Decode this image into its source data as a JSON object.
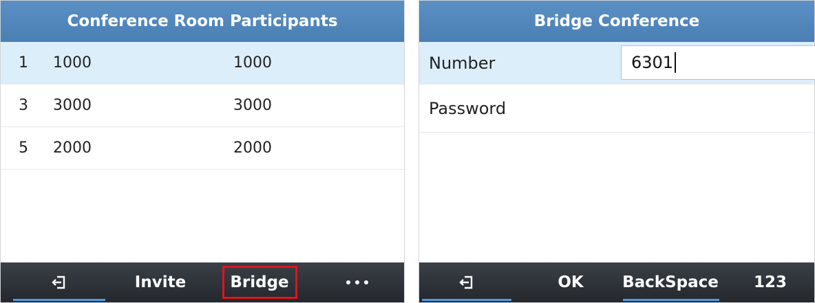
{
  "left": {
    "title": "Conference Room Participants",
    "participants": [
      {
        "index": "1",
        "number": "1000",
        "name": "1000",
        "selected": true
      },
      {
        "index": "3",
        "number": "3000",
        "name": "3000",
        "selected": false
      },
      {
        "index": "5",
        "number": "2000",
        "name": "2000",
        "selected": false
      }
    ],
    "softkeys": {
      "exit_icon": "exit-icon",
      "invite": "Invite",
      "bridge": "Bridge",
      "more_icon": "more-dots-icon"
    },
    "highlighted_softkey": "Bridge"
  },
  "right": {
    "title": "Bridge Conference",
    "number_label": "Number",
    "number_value": "6301",
    "password_label": "Password",
    "softkeys": {
      "exit_icon": "exit-icon",
      "ok": "OK",
      "backspace": "BackSpace",
      "input_mode": "123"
    }
  },
  "colors": {
    "title_bar": "#5a90c4",
    "selected_row": "#dceefa",
    "softkey_bar": "#2e3338",
    "accent_underline": "#4a9ee6",
    "highlight_box": "#e0141e"
  }
}
